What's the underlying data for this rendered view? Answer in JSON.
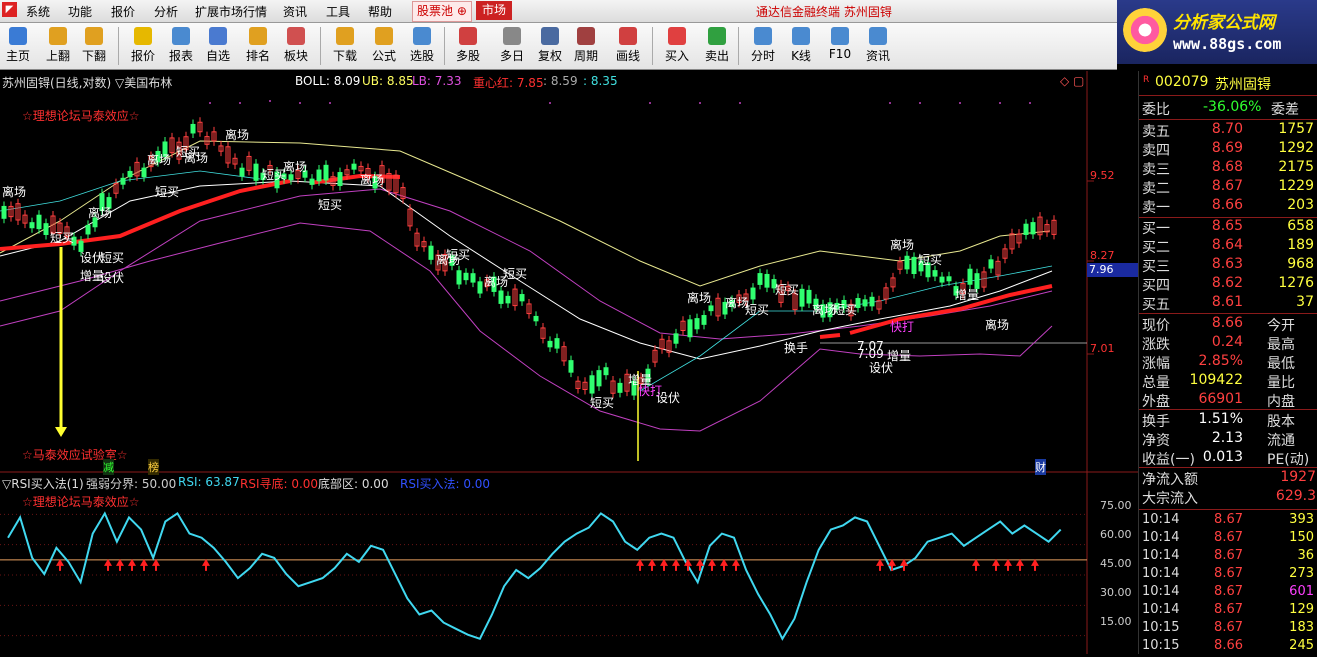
{
  "menu": {
    "items": [
      "系统",
      "功能",
      "报价",
      "分析",
      "扩展市场行情",
      "资讯",
      "工具",
      "帮助"
    ],
    "pool_tab": "股票池",
    "market_tab": "市场",
    "title": "通达信金融终端  苏州固锝"
  },
  "brand": {
    "title": "分析家公式网",
    "url": "www.88gs.com"
  },
  "toolbar": {
    "buttons": [
      {
        "label": "主页",
        "icon": "home-icon",
        "color": "#3a7bd5"
      },
      {
        "label": "上翻",
        "icon": "arrow-up-icon",
        "color": "#e0a020"
      },
      {
        "label": "下翻",
        "icon": "arrow-down-icon",
        "color": "#e0a020"
      },
      {
        "label": "报价",
        "icon": "quote-icon",
        "color": "#e6b800"
      },
      {
        "label": "报表",
        "icon": "report-icon",
        "color": "#4a8ad0"
      },
      {
        "label": "自选",
        "icon": "f6-icon",
        "color": "#4a7ad0"
      },
      {
        "label": "排名",
        "icon": "rank-icon",
        "color": "#e0a020"
      },
      {
        "label": "板块",
        "icon": "sector-icon",
        "color": "#d05050"
      },
      {
        "label": "下载",
        "icon": "download-icon",
        "color": "#e0a020"
      },
      {
        "label": "公式",
        "icon": "formula-icon",
        "color": "#e0a020"
      },
      {
        "label": "选股",
        "icon": "select-stock-icon",
        "color": "#4a8ad0"
      },
      {
        "label": "多股",
        "icon": "multi-stock-icon",
        "color": "#d04040"
      },
      {
        "label": "多日",
        "icon": "multi-day-icon",
        "color": "#888888"
      },
      {
        "label": "复权",
        "icon": "restore-icon",
        "color": "#4a6aa0"
      },
      {
        "label": "周期",
        "icon": "period-icon",
        "color": "#a04040"
      },
      {
        "label": "画线",
        "icon": "draw-line-icon",
        "color": "#d04040"
      },
      {
        "label": "买入",
        "icon": "buy-icon",
        "color": "#e04040"
      },
      {
        "label": "卖出",
        "icon": "sell-icon",
        "color": "#30a040"
      },
      {
        "label": "分时",
        "icon": "intraday-icon",
        "color": "#4a8ad0"
      },
      {
        "label": "K线",
        "icon": "kline-icon",
        "color": "#4a8ad0"
      },
      {
        "label": "F10",
        "icon": "f10-icon",
        "color": "#4a8ad0"
      },
      {
        "label": "资讯",
        "icon": "news-icon",
        "color": "#4a8ad0"
      }
    ]
  },
  "main_chart": {
    "stock_label": "苏州固锝(日线,对数) ▽美国布林",
    "boll": "BOLL: 8.09",
    "ub": "UB: 8.85",
    "lb": "LB: 7.33",
    "center_label": "重心红: 7.85",
    "v2": ": 8.59",
    "v3": ": 8.35",
    "watermark_top": "☆理想论坛马泰效应☆",
    "watermark_bottom": "☆马泰效应试验室☆",
    "y_ticks": [
      "9.52",
      "8.27",
      "7.01"
    ],
    "current_price_tag": "7.96",
    "marks": [
      "减",
      "榜",
      "财"
    ],
    "annotations": [
      {
        "text": "离场",
        "color": "#ffffff"
      },
      {
        "text": "短买",
        "color": "#ffffff"
      },
      {
        "text": "离场",
        "color": "#ffffff"
      },
      {
        "text": "设伏",
        "color": "#ffffff"
      },
      {
        "text": "短买",
        "color": "#ffffff"
      },
      {
        "text": "增量",
        "color": "#ffffff"
      },
      {
        "text": "设伏",
        "color": "#ffffff"
      },
      {
        "text": "离场",
        "color": "#ffffff"
      },
      {
        "text": "离场",
        "color": "#ffffff"
      },
      {
        "text": "短买",
        "color": "#ffffff"
      },
      {
        "text": "离场",
        "color": "#ffffff"
      },
      {
        "text": "短买",
        "color": "#ffffff"
      },
      {
        "text": "离场",
        "color": "#ffffff"
      },
      {
        "text": "短买",
        "color": "#ffffff"
      },
      {
        "text": "离场",
        "color": "#ffffff"
      },
      {
        "text": "短买",
        "color": "#ffffff"
      },
      {
        "text": "短买",
        "color": "#ffffff"
      },
      {
        "text": "离场",
        "color": "#ffffff"
      },
      {
        "text": "短买",
        "color": "#ffffff"
      },
      {
        "text": "离场",
        "color": "#ffffff"
      },
      {
        "text": "短买",
        "color": "#ffffff"
      },
      {
        "text": "增量",
        "color": "#ffffff"
      },
      {
        "text": "快打",
        "color": "#ff40ff"
      },
      {
        "text": "设伏",
        "color": "#ffffff"
      },
      {
        "text": "离场",
        "color": "#ffffff"
      },
      {
        "text": "离场",
        "color": "#ffffff"
      },
      {
        "text": "短买",
        "color": "#ffffff"
      },
      {
        "text": "短买",
        "color": "#ffffff"
      },
      {
        "text": "离场",
        "color": "#ffffff"
      },
      {
        "text": "换手",
        "color": "#ffffff"
      },
      {
        "text": "短买",
        "color": "#ffffff"
      },
      {
        "text": "7.07",
        "color": "#ffffff"
      },
      {
        "text": "7.09",
        "color": "#ffffff"
      },
      {
        "text": "增量",
        "color": "#ffffff"
      },
      {
        "text": "设伏",
        "color": "#ffffff"
      },
      {
        "text": "快打",
        "color": "#ff40ff"
      },
      {
        "text": "离场",
        "color": "#ffffff"
      },
      {
        "text": "短买",
        "color": "#ffffff"
      },
      {
        "text": "增量",
        "color": "#ffffff"
      },
      {
        "text": "离场",
        "color": "#ffffff"
      }
    ]
  },
  "rsi_chart": {
    "title": "▽RSI买入法(1)",
    "strength": "强弱分界: 50.00",
    "rsi": "RSI: 63.87",
    "rsi_bottom": "RSI寻底: 0.00",
    "bottom_zone": "底部区: 0.00",
    "rsi_buy": "RSI买入法: 0.00",
    "watermark": "☆理想论坛马泰效应☆",
    "y_ticks": [
      "75.00",
      "60.00",
      "45.00",
      "30.00",
      "15.00"
    ]
  },
  "quote": {
    "code": "002079",
    "name": "苏州固锝",
    "ratio_label": "委比",
    "ratio_value": "-36.06%",
    "diff_label": "委差",
    "asks": [
      {
        "label": "卖五",
        "price": "8.70",
        "vol": "1757"
      },
      {
        "label": "卖四",
        "price": "8.69",
        "vol": "1292"
      },
      {
        "label": "卖三",
        "price": "8.68",
        "vol": "2175"
      },
      {
        "label": "卖二",
        "price": "8.67",
        "vol": "1229"
      },
      {
        "label": "卖一",
        "price": "8.66",
        "vol": "203"
      }
    ],
    "bids": [
      {
        "label": "买一",
        "price": "8.65",
        "vol": "658"
      },
      {
        "label": "买二",
        "price": "8.64",
        "vol": "189"
      },
      {
        "label": "买三",
        "price": "8.63",
        "vol": "968"
      },
      {
        "label": "买四",
        "price": "8.62",
        "vol": "1276"
      },
      {
        "label": "买五",
        "price": "8.61",
        "vol": "37"
      }
    ],
    "stats": [
      {
        "l1": "现价",
        "v1": "8.66",
        "l2": "今开",
        "c": "#ff4040"
      },
      {
        "l1": "涨跌",
        "v1": "0.24",
        "l2": "最高",
        "c": "#ff4040"
      },
      {
        "l1": "涨幅",
        "v1": "2.85%",
        "l2": "最低",
        "c": "#ff4040"
      },
      {
        "l1": "总量",
        "v1": "109422",
        "l2": "量比",
        "c": "#ffff40"
      },
      {
        "l1": "外盘",
        "v1": "66901",
        "l2": "内盘",
        "c": "#ff4040"
      }
    ],
    "stats2": [
      {
        "l1": "换手",
        "v1": "1.51%",
        "l2": "股本"
      },
      {
        "l1": "净资",
        "v1": "2.13",
        "l2": "流通"
      },
      {
        "l1": "收益(一)",
        "v1": "0.013",
        "l2": "PE(动)"
      }
    ],
    "flow": [
      {
        "label": "净流入额",
        "value": "1927"
      },
      {
        "label": "大宗流入",
        "value": "629.3"
      }
    ],
    "ticks": [
      {
        "time": "10:14",
        "price": "8.67",
        "vol": "393",
        "vc": "#ffff40"
      },
      {
        "time": "10:14",
        "price": "8.67",
        "vol": "150",
        "vc": "#ffff40"
      },
      {
        "time": "10:14",
        "price": "8.67",
        "vol": "36",
        "vc": "#ffff40"
      },
      {
        "time": "10:14",
        "price": "8.67",
        "vol": "273",
        "vc": "#ffff40"
      },
      {
        "time": "10:14",
        "price": "8.67",
        "vol": "601",
        "vc": "#ff40ff"
      },
      {
        "time": "10:14",
        "price": "8.67",
        "vol": "129",
        "vc": "#ffff40"
      },
      {
        "time": "10:15",
        "price": "8.67",
        "vol": "183",
        "vc": "#ffff40"
      },
      {
        "time": "10:15",
        "price": "8.66",
        "vol": "245",
        "vc": "#ffff40"
      }
    ]
  },
  "colors": {
    "up": "#ff4040",
    "down": "#00ffff",
    "ma_red": "#ff2020",
    "upper": "#e8e890",
    "lower": "#c040c0",
    "rsi": "#40d8f0"
  }
}
